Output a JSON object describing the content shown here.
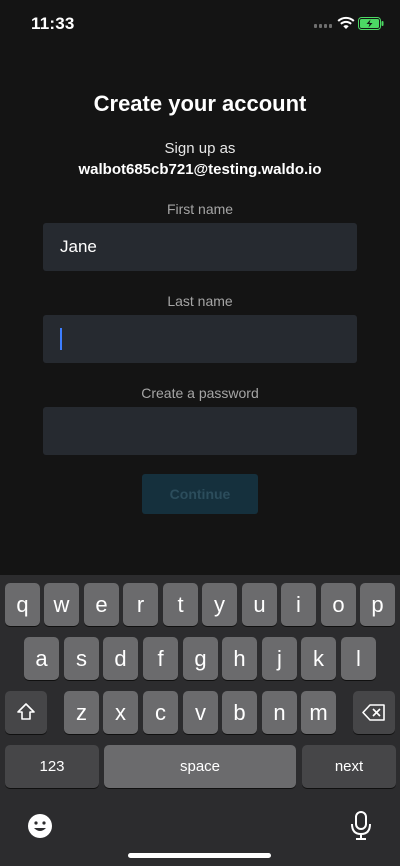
{
  "status_bar": {
    "time": "11:33"
  },
  "form": {
    "title": "Create your account",
    "signup_as": "Sign up as",
    "email": "walbot685cb721@testing.waldo.io",
    "first_name_label": "First name",
    "first_name_value": "Jane",
    "last_name_label": "Last name",
    "last_name_value": "",
    "password_label": "Create a password",
    "password_value": "",
    "continue_label": "Continue"
  },
  "keyboard": {
    "row1": [
      "q",
      "w",
      "e",
      "r",
      "t",
      "y",
      "u",
      "i",
      "o",
      "p"
    ],
    "row2": [
      "a",
      "s",
      "d",
      "f",
      "g",
      "h",
      "j",
      "k",
      "l"
    ],
    "row3": [
      "z",
      "x",
      "c",
      "v",
      "b",
      "n",
      "m"
    ],
    "numbers_label": "123",
    "space_label": "space",
    "next_label": "next"
  },
  "colors": {
    "background": "#141414",
    "field": "#262a30",
    "caret": "#3d7eff",
    "button_disabled": "#15303d",
    "battery": "#4cd964"
  },
  "icons": [
    "wifi-icon",
    "battery-charging-icon",
    "shift-icon",
    "backspace-icon",
    "emoji-icon",
    "microphone-icon"
  ]
}
